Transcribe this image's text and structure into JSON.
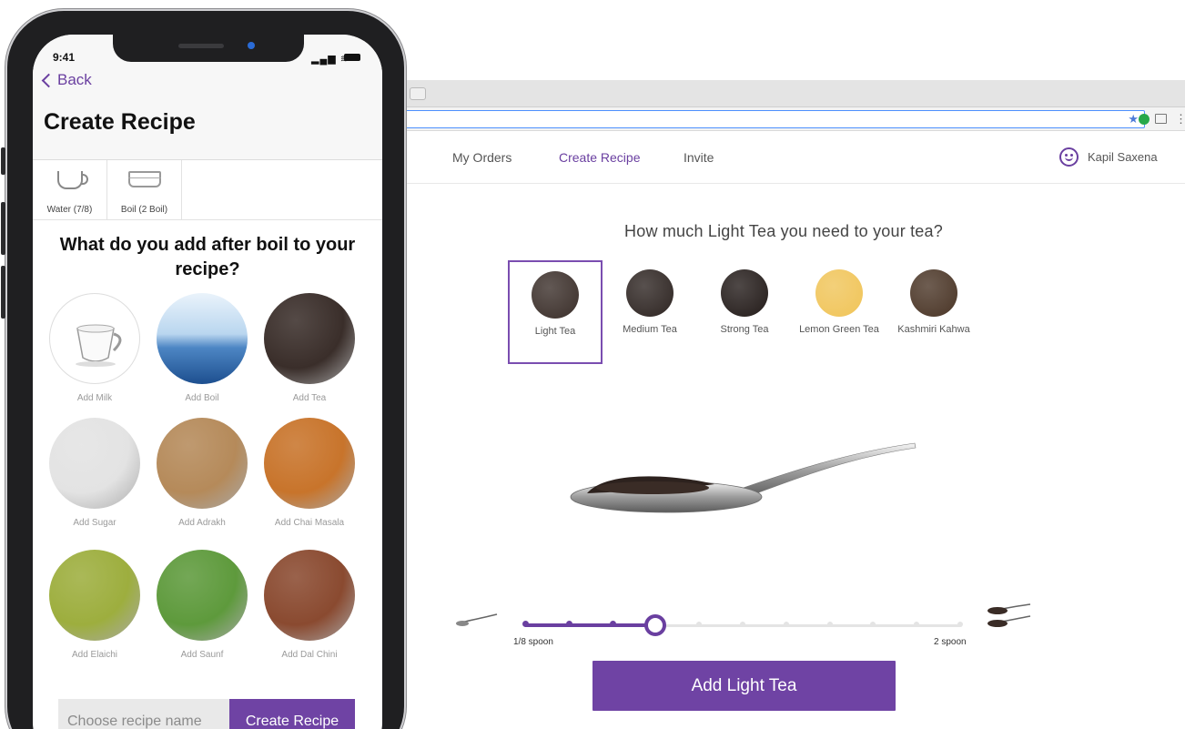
{
  "browser": {
    "nav": {
      "my_orders": "My Orders",
      "create_recipe": "Create Recipe",
      "invite": "Invite",
      "user_name": "Kapil Saxena"
    },
    "question": "How much Light Tea you need to your tea?",
    "tea_options": [
      {
        "label": "Light Tea",
        "color": "#3b2f2a",
        "selected": true
      },
      {
        "label": "Medium Tea",
        "color": "#2e2522",
        "selected": false
      },
      {
        "label": "Strong Tea",
        "color": "#231b19",
        "selected": false
      },
      {
        "label": "Lemon Green Tea",
        "color": "#f0c458",
        "selected": false
      },
      {
        "label": "Kashmiri Kahwa",
        "color": "#4a3526",
        "selected": false
      }
    ],
    "slider": {
      "min_label": "1/8 spoon",
      "max_label": "2 spoon",
      "steps": 10,
      "current_step": 3
    },
    "add_button": "Add Light Tea",
    "accent_color": "#6f43a4"
  },
  "phone": {
    "time": "9:41",
    "back_label": "Back",
    "title": "Create Recipe",
    "steps": [
      {
        "label": "Water (7/8)",
        "icon": "cup-icon"
      },
      {
        "label": "Boil (2 Boil)",
        "icon": "pan-icon"
      }
    ],
    "question": "What do you add after boil to your recipe?",
    "ingredients": [
      {
        "label": "Add Milk",
        "icon": "milk-cup-icon",
        "color": "#ffffff"
      },
      {
        "label": "Add Boil",
        "icon": "boiling-water-icon",
        "color": "#9fc4e6"
      },
      {
        "label": "Add Tea",
        "icon": "tea-leaves-icon",
        "color": "#3a2e2a"
      },
      {
        "label": "Add Sugar",
        "icon": "sugar-icon",
        "color": "#e3e3e3"
      },
      {
        "label": "Add Adrakh",
        "icon": "ginger-icon",
        "color": "#b58a5a"
      },
      {
        "label": "Add Chai Masala",
        "icon": "masala-icon",
        "color": "#c8742b"
      },
      {
        "label": "Add Elaichi",
        "icon": "cardamom-icon",
        "color": "#9dae3e"
      },
      {
        "label": "Add Saunf",
        "icon": "fennel-icon",
        "color": "#5e9a3c"
      },
      {
        "label": "Add Dal Chini",
        "icon": "cinnamon-icon",
        "color": "#8a4a30"
      }
    ],
    "recipe_placeholder": "Choose recipe name",
    "create_button": "Create Recipe"
  }
}
